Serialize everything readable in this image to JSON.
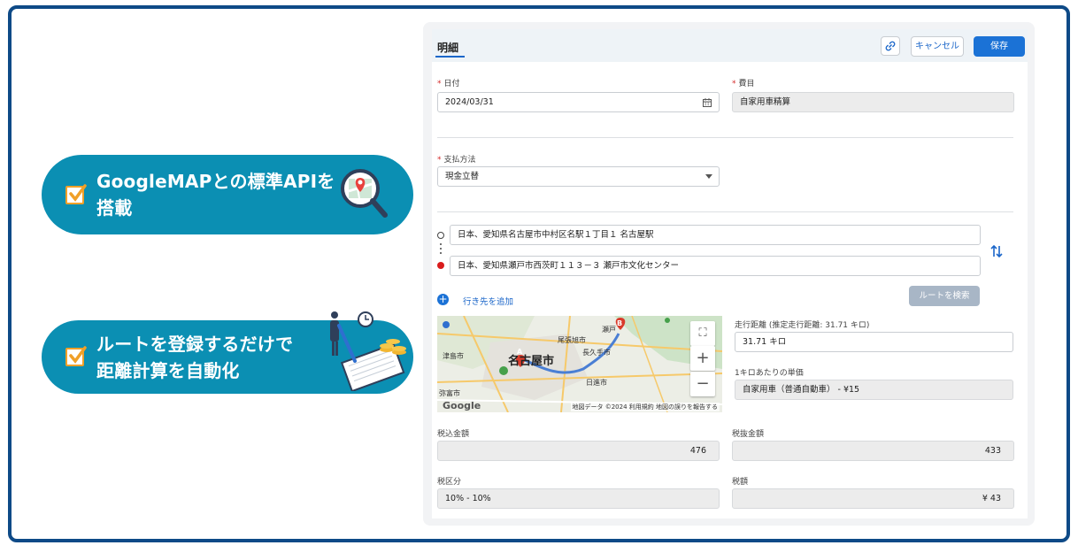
{
  "features": [
    {
      "line1": "GoogleMAPとの標準APIを",
      "line2": "搭載"
    },
    {
      "line1": "ルートを登録するだけで",
      "line2": "距離計算を自動化"
    }
  ],
  "header": {
    "tab": "明細",
    "cancel_label": "キャンセル",
    "save_label": "保存"
  },
  "form": {
    "date": {
      "label": "日付",
      "value": "2024/03/31"
    },
    "item": {
      "label": "費目",
      "value": "自家用車精算"
    },
    "payment": {
      "label": "支払方法",
      "value": "現金立替"
    },
    "route": {
      "origin": "日本、愛知県名古屋市中村区名駅１丁目１ 名古屋駅",
      "destination": "日本、愛知県瀬戸市西茨町１１３－３ 瀬戸市文化センター",
      "add_waypoint": "行き先を追加",
      "search_button": "ルートを検索"
    },
    "distance": {
      "label": "走行距離 (推定走行距離: 31.71 キロ)",
      "value": "31.71 キロ"
    },
    "unit_price": {
      "label": "1キロあたりの単価",
      "value": "自家用車（普通自動車） - ¥15"
    },
    "amount_incl_tax": {
      "label": "税込金額",
      "value": "476"
    },
    "amount_excl_tax": {
      "label": "税抜金額",
      "value": "433"
    },
    "tax_class": {
      "label": "税区分",
      "value": "10% - 10%"
    },
    "tax_amount": {
      "label": "税額",
      "value": "¥ 43"
    }
  },
  "map": {
    "city": "名古屋市",
    "labels": [
      "尾張旭市",
      "長久手市",
      "日進市",
      "津島市",
      "弥富市",
      "瀬戸"
    ],
    "marker_a": "A",
    "marker_b": "B",
    "google": "Google",
    "credit": "地図データ ©2024   利用規約   地図の誤りを報告する"
  },
  "colors": {
    "accent": "#1b72d6",
    "pill": "#0b8fb3",
    "frame": "#0e4a87",
    "check": "#f0a028"
  }
}
